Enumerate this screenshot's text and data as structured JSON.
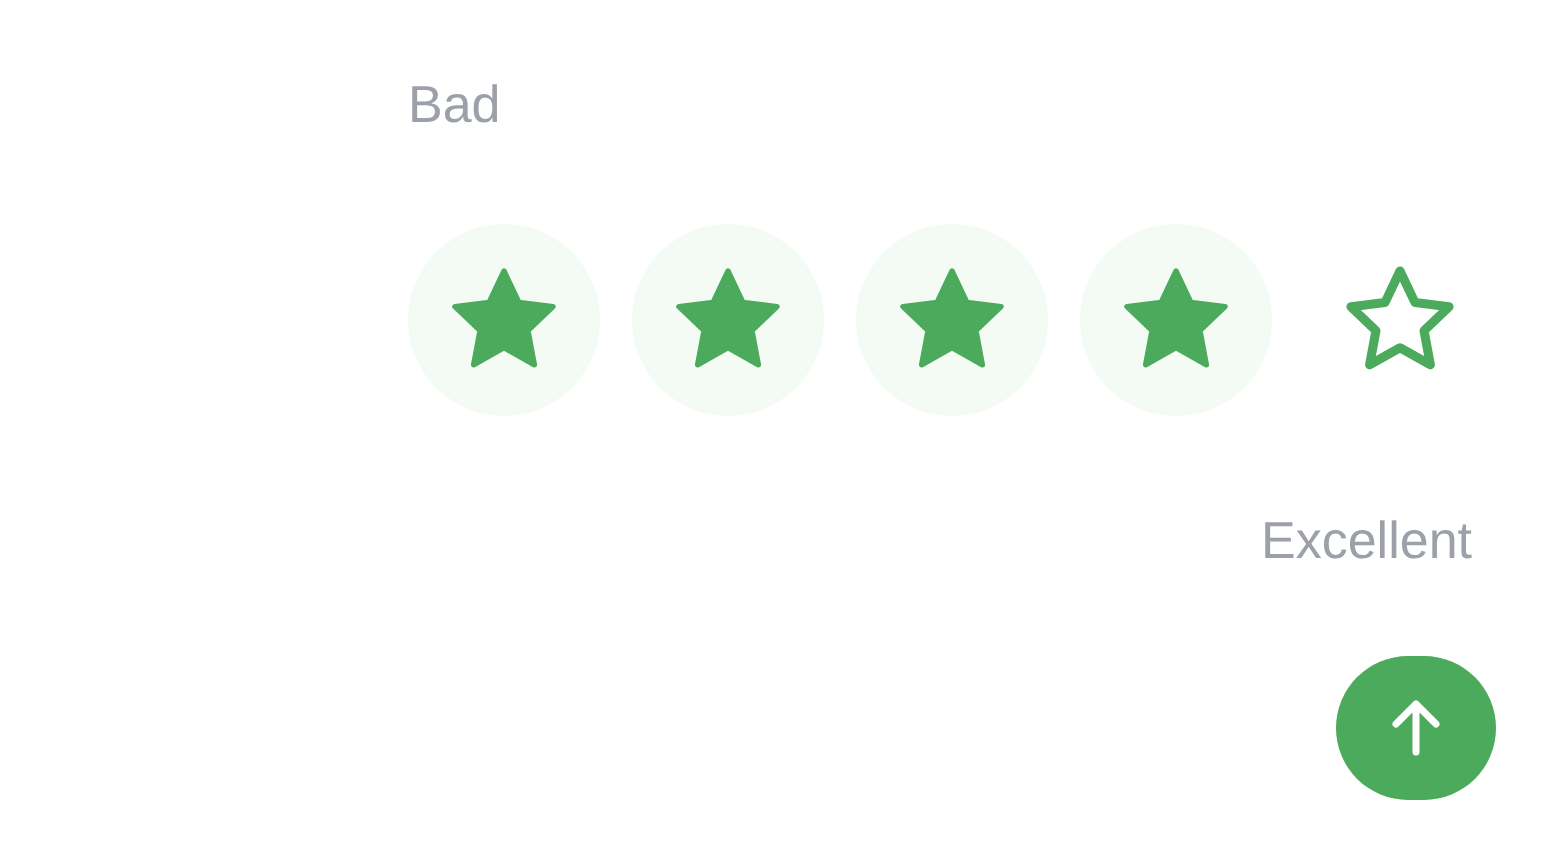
{
  "rating": {
    "low_label": "Bad",
    "stars": 4,
    "high_label": "Excellent"
  }
}
